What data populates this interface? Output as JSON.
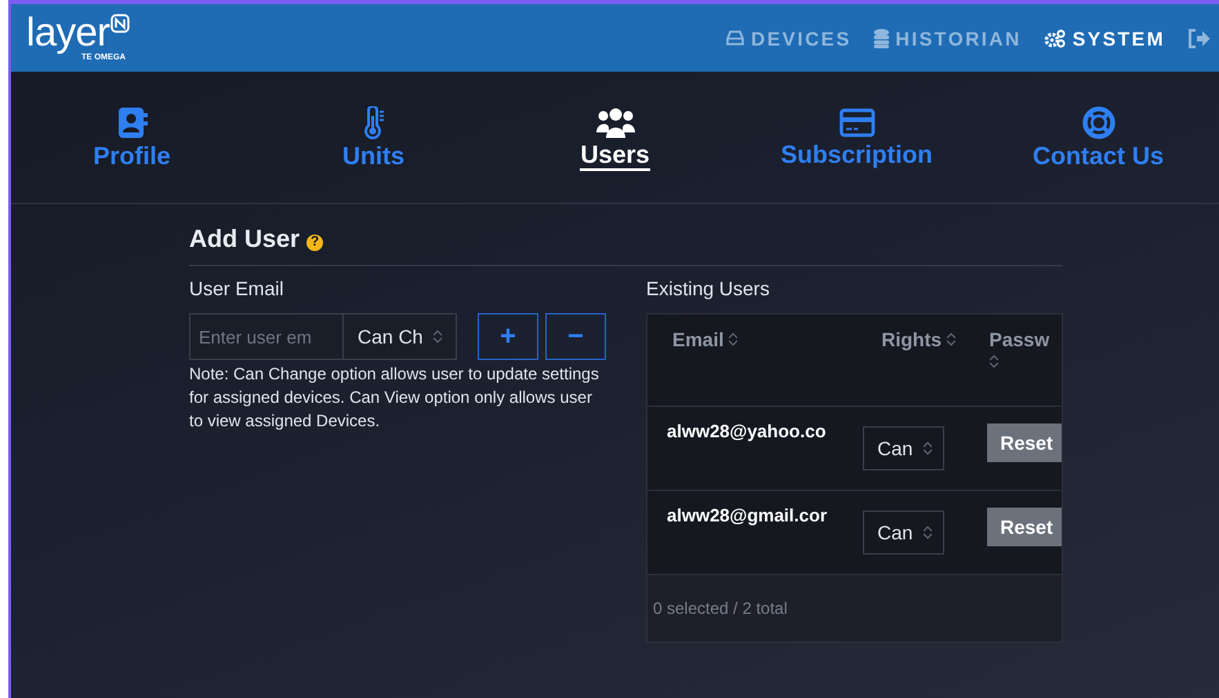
{
  "header": {
    "brand": "layer",
    "brand_sub": "TE OMEGA",
    "nav": [
      {
        "label": "DEVICES",
        "kind": "drive",
        "selected": false
      },
      {
        "label": "HISTORIAN",
        "kind": "database",
        "selected": false
      },
      {
        "label": "SYSTEM",
        "kind": "gears",
        "selected": true
      }
    ]
  },
  "tabs": [
    {
      "label": "Profile",
      "kind": "contact",
      "selected": false
    },
    {
      "label": "Units",
      "kind": "thermometer",
      "selected": false
    },
    {
      "label": "Users",
      "kind": "users",
      "selected": true
    },
    {
      "label": "Subscription",
      "kind": "card",
      "selected": false
    },
    {
      "label": "Contact Us",
      "kind": "lifebuoy",
      "selected": false
    }
  ],
  "add_user": {
    "title": "Add User",
    "help": "?",
    "email_label": "User Email",
    "email_field": {
      "placeholder": "Enter user em"
    },
    "rights_select": "Can Ch",
    "add_button": "+",
    "remove_button": "−",
    "note": "Note: Can Change option allows user to update settings for assigned devices. Can View option only allows user to view assigned Devices."
  },
  "existing_users": {
    "title": "Existing Users",
    "columns": [
      "Email",
      "Rights",
      "Passw"
    ],
    "rows": [
      {
        "email": "alww28@yahoo.co",
        "rights": "Can",
        "password_button": "Reset"
      },
      {
        "email": "alww28@gmail.cor",
        "rights": "Can",
        "password_button": "Reset"
      }
    ],
    "footer": "0 selected / 2 total"
  }
}
